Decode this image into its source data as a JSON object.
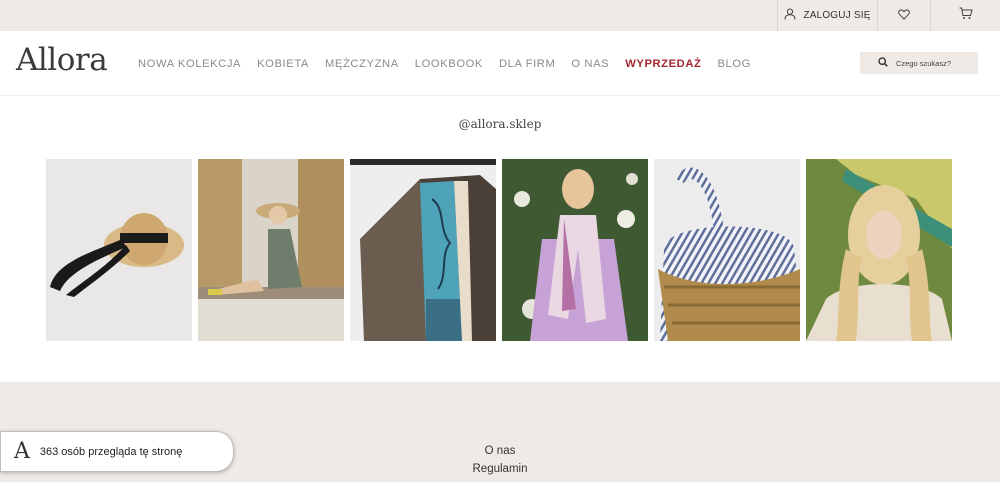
{
  "topbar": {
    "login_label": "ZALOGUJ SIĘ",
    "login_icon": "user-icon",
    "wishlist_icon": "heart-icon",
    "cart_icon": "cart-icon"
  },
  "header": {
    "logo": "Allora",
    "nav": [
      {
        "label": "NOWA KOLEKCJA"
      },
      {
        "label": "KOBIETA"
      },
      {
        "label": "MĘŻCZYZNA"
      },
      {
        "label": "LOOKBOOK"
      },
      {
        "label": "DLA FIRM"
      },
      {
        "label": "O NAS"
      },
      {
        "label": "WYPRZEDAŻ",
        "highlight": true
      },
      {
        "label": "BLOG"
      }
    ],
    "search_placeholder": "Czego szukasz?",
    "search_icon": "search-icon"
  },
  "instagram": {
    "handle": "@allora.sklep",
    "tiles": [
      {
        "subject": "straw hat with black ribbon"
      },
      {
        "subject": "woman in straw hat on bench"
      },
      {
        "subject": "silk scarf on jacket"
      },
      {
        "subject": "woman in lilac suit with scarf"
      },
      {
        "subject": "striped woven basket bag"
      },
      {
        "subject": "blonde woman with scarf"
      }
    ]
  },
  "footer": {
    "links": [
      "O nas",
      "Regulamin"
    ]
  },
  "visitors_popup": {
    "avatar_letter": "A",
    "text": "363 osób przegląda tę stronę"
  },
  "colors": {
    "bar_bg": "#efeae6",
    "sale": "#a3262e",
    "nav_text": "#8a8a8a"
  }
}
